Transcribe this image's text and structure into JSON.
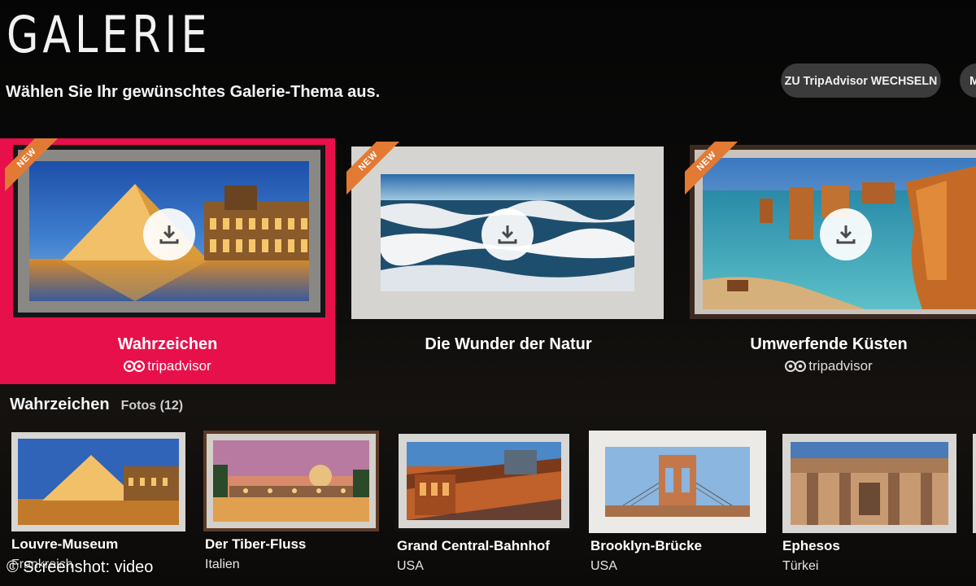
{
  "header": {
    "title": "GALERIE",
    "subtitle": "Wählen Sie Ihr gewünschtes Galerie-Thema aus.",
    "switch_button": "ZU TripAdvisor WECHSELN",
    "more_button": "M"
  },
  "themes": [
    {
      "title": "Wahrzeichen",
      "badge": "NEW",
      "provider": "tripadvisor",
      "selected": true,
      "icon": "download-icon"
    },
    {
      "title": "Die Wunder der Natur",
      "badge": "NEW",
      "provider": "",
      "selected": false,
      "icon": "download-icon"
    },
    {
      "title": "Umwerfende Küsten",
      "badge": "NEW",
      "provider": "tripadvisor",
      "selected": false,
      "icon": "download-icon"
    }
  ],
  "section": {
    "title": "Wahrzeichen",
    "count": "Fotos (12)"
  },
  "photos": [
    {
      "name": "Louvre-Museum",
      "country": "Frankreich"
    },
    {
      "name": "Der Tiber-Fluss",
      "country": "Italien"
    },
    {
      "name": "Grand Central-Bahnhof",
      "country": "USA"
    },
    {
      "name": "Brooklyn-Brücke",
      "country": "USA"
    },
    {
      "name": "Ephesos",
      "country": "Türkei"
    }
  ],
  "watermark": "© Screenshot: video",
  "colors": {
    "selected": "#e8104a",
    "badge": "#e27a34",
    "button_bg": "#3b3b3b"
  }
}
